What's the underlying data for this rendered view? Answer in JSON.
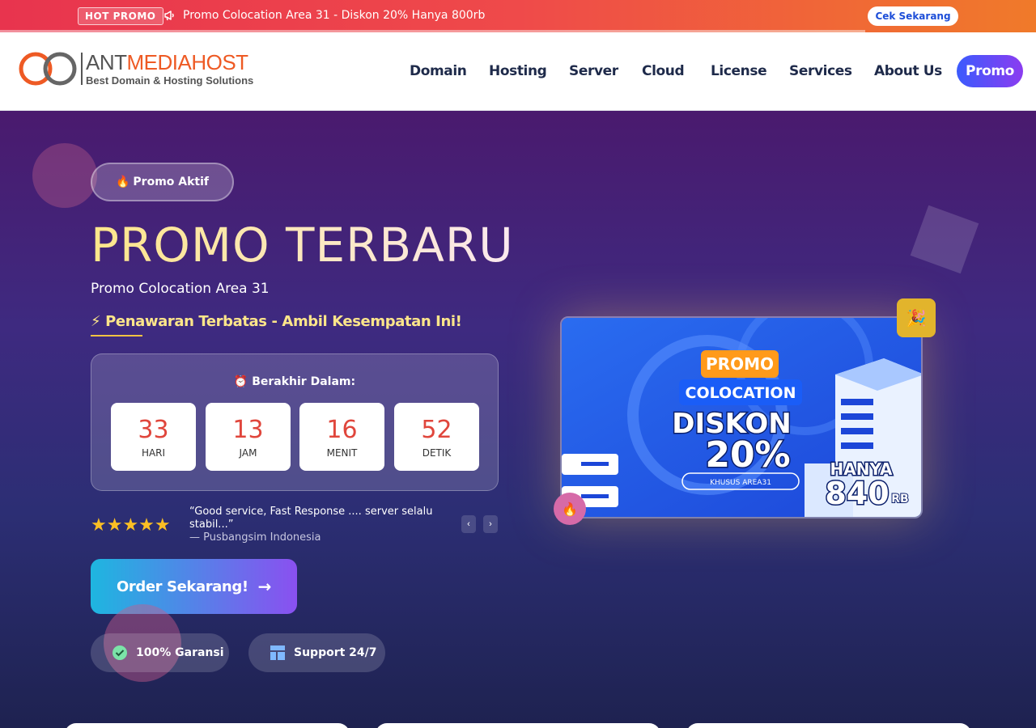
{
  "topbar": {
    "badge": "HOT PROMO",
    "promo_text": "Promo Colocation Area 31 - Diskon 20% Hanya 800rb",
    "cta": "Cek Sekarang"
  },
  "header": {
    "logo_name_ant": "ANT",
    "logo_name_rest": "MEDIAHOST",
    "logo_tagline": "Best Domain & Hosting Solutions",
    "nav": [
      "Domain",
      "Hosting",
      "Server",
      "Cloud",
      "License",
      "Services",
      "About Us"
    ],
    "promo_label": "Promo"
  },
  "hero": {
    "badge": "Promo Aktif",
    "title": "PROMO TERBARU",
    "subtitle": "Promo Colocation Area 31",
    "limited": "⚡ Penawaran Terbatas - Ambil Kesempatan Ini!",
    "countdown_label": "⏰ Berakhir Dalam:",
    "countdown": [
      {
        "value": "33",
        "unit": "HARI"
      },
      {
        "value": "13",
        "unit": "JAM"
      },
      {
        "value": "16",
        "unit": "MENIT"
      },
      {
        "value": "52",
        "unit": "DETIK"
      }
    ],
    "stars": "★★★★★",
    "testimonial": "“Good service, Fast Response .... server selalu stabil...”",
    "testimonial_author": "— Pusbangsim Indonesia",
    "prev_label": "‹",
    "next_label": "›",
    "order_label": "Order Sekarang!",
    "features": [
      "100% Garansi",
      "Support 24/7"
    ]
  },
  "banner": {
    "promo": "PROMO",
    "colocation": "COLOCATION",
    "diskon": "DISKON",
    "percent": "20%",
    "khusus": "KHUSUS AREA31",
    "hanya": "HANYA",
    "price": "840",
    "rb": "RB"
  },
  "colors": {
    "accent": "#3b5bfd",
    "hot": "#e8344e",
    "countdown_num": "#e0463c",
    "title": "#fde68a"
  }
}
